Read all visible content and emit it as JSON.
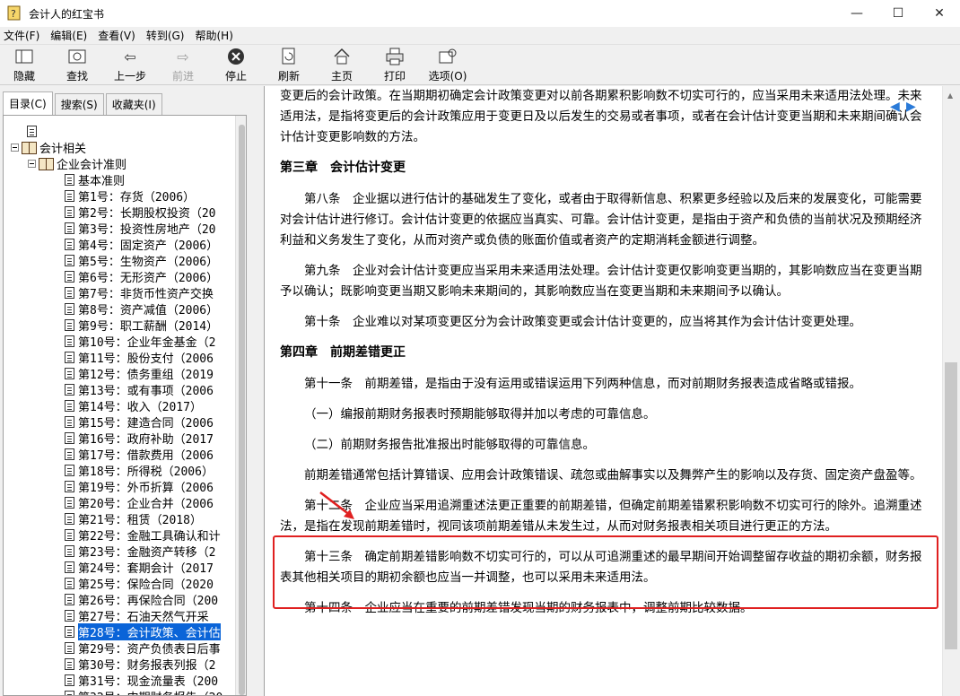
{
  "window": {
    "title": "会计人的红宝书"
  },
  "menu": [
    "文件(F)",
    "编辑(E)",
    "查看(V)",
    "转到(G)",
    "帮助(H)"
  ],
  "toolbar": [
    {
      "label": "隐藏",
      "icon": "hide-icon",
      "enabled": true
    },
    {
      "label": "查找",
      "icon": "find-icon",
      "enabled": true
    },
    {
      "label": "上一步",
      "icon": "back-icon",
      "enabled": true
    },
    {
      "label": "前进",
      "icon": "forward-icon",
      "enabled": false
    },
    {
      "label": "停止",
      "icon": "stop-icon",
      "enabled": true
    },
    {
      "label": "刷新",
      "icon": "refresh-icon",
      "enabled": true
    },
    {
      "label": "主页",
      "icon": "home-icon",
      "enabled": true
    },
    {
      "label": "打印",
      "icon": "print-icon",
      "enabled": true
    },
    {
      "label": "选项(O)",
      "icon": "options-icon",
      "enabled": true
    }
  ],
  "tabs": [
    "目录(C)",
    "搜索(S)",
    "收藏夹(I)"
  ],
  "tree": {
    "root_label": "会计相关",
    "folder_label": "企业会计准则",
    "items": [
      "基本准则",
      "第1号：存货（2006）",
      "第2号：长期股权投资（20",
      "第3号：投资性房地产（20",
      "第4号：固定资产（2006）",
      "第5号：生物资产（2006）",
      "第6号：无形资产（2006）",
      "第7号：非货币性资产交换",
      "第8号：资产减值（2006）",
      "第9号：职工薪酬（2014）",
      "第10号：企业年金基金（2",
      "第11号：股份支付（2006",
      "第12号：债务重组（2019",
      "第13号：或有事项（2006",
      "第14号：收入（2017）",
      "第15号：建造合同（2006",
      "第16号：政府补助（2017",
      "第17号：借款费用（2006",
      "第18号：所得税（2006）",
      "第19号：外币折算（2006",
      "第20号：企业合并（2006",
      "第21号：租赁（2018）",
      "第22号：金融工具确认和计",
      "第23号：金融资产转移（2",
      "第24号：套期会计（2017",
      "第25号：保险合同（2020",
      "第26号：再保险合同（200",
      "第27号：石油天然气开采",
      "第28号：会计政策、会计估",
      "第29号：资产负债表日后事",
      "第30号：财务报表列报（2",
      "第31号：现金流量表（200",
      "第32号：中期财务报告（20"
    ],
    "selected_index": 28
  },
  "content": {
    "blocks": [
      {
        "type": "para",
        "indent": false,
        "text": "变更后的会计政策。在当期期初确定会计政策变更对以前各期累积影响数不切实可行的，应当采用未来适用法处理。未来适用法，是指将变更后的会计政策应用于变更日及以后发生的交易或者事项，或者在会计估计变更当期和未来期间确认会计估计变更影响数的方法。"
      },
      {
        "type": "chapter",
        "text": "第三章　会计估计变更"
      },
      {
        "type": "para",
        "indent": true,
        "text": "第八条　企业据以进行估计的基础发生了变化，或者由于取得新信息、积累更多经验以及后来的发展变化，可能需要对会计估计进行修订。会计估计变更的依据应当真实、可靠。会计估计变更，是指由于资产和负债的当前状况及预期经济利益和义务发生了变化，从而对资产或负债的账面价值或者资产的定期消耗金额进行调整。"
      },
      {
        "type": "para",
        "indent": true,
        "text": "第九条　企业对会计估计变更应当采用未来适用法处理。会计估计变更仅影响变更当期的，其影响数应当在变更当期予以确认；既影响变更当期又影响未来期间的，其影响数应当在变更当期和未来期间予以确认。"
      },
      {
        "type": "para",
        "indent": true,
        "text": "第十条　企业难以对某项变更区分为会计政策变更或会计估计变更的，应当将其作为会计估计变更处理。"
      },
      {
        "type": "chapter",
        "text": "第四章　前期差错更正"
      },
      {
        "type": "para",
        "indent": true,
        "text": "第十一条　前期差错，是指由于没有运用或错误运用下列两种信息，而对前期财务报表造成省略或错报。"
      },
      {
        "type": "para",
        "indent": true,
        "text": "（一）编报前期财务报表时预期能够取得并加以考虑的可靠信息。"
      },
      {
        "type": "para",
        "indent": true,
        "text": "（二）前期财务报告批准报出时能够取得的可靠信息。"
      },
      {
        "type": "para",
        "indent": true,
        "text": "前期差错通常包括计算错误、应用会计政策错误、疏忽或曲解事实以及舞弊产生的影响以及存货、固定资产盘盈等。"
      },
      {
        "type": "para",
        "indent": true,
        "text": "第十二条　企业应当采用追溯重述法更正重要的前期差错，但确定前期差错累积影响数不切实可行的除外。追溯重述法，是指在发现前期差错时，视同该项前期差错从未发生过，从而对财务报表相关项目进行更正的方法。"
      },
      {
        "type": "para",
        "indent": true,
        "text": "第十三条　确定前期差错影响数不切实可行的，可以从可追溯重述的最早期间开始调整留存收益的期初余额，财务报表其他相关项目的期初余额也应当一并调整，也可以采用未来适用法。"
      },
      {
        "type": "para",
        "indent": true,
        "text": "第十四条　企业应当在重要的前期差错发现当期的财务报表中，调整前期比较数据。"
      }
    ]
  },
  "colors": {
    "highlight_border": "#e02020",
    "selection": "#0a64d8",
    "nav_arrow": "#2a7ad8"
  }
}
